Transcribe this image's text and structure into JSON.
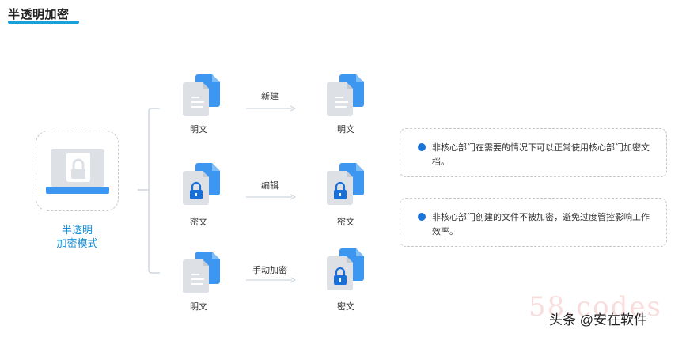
{
  "title": "半透明加密",
  "mode_label": [
    "半透明",
    "加密模式"
  ],
  "rows": [
    {
      "source_label": "明文",
      "action": "新建",
      "target_label": "明文",
      "source_locked": false,
      "target_locked": false
    },
    {
      "source_label": "密文",
      "action": "编辑",
      "target_label": "密文",
      "source_locked": true,
      "target_locked": true
    },
    {
      "source_label": "明文",
      "action": "手动加密",
      "target_label": "密文",
      "source_locked": false,
      "target_locked": true
    }
  ],
  "notes": [
    "非核心部门在需要的情况下可以正常使用核心部门加密文档。",
    "非核心部门创建的文件不被加密，避免过度管控影响工作效率。"
  ],
  "watermark": "头条 @安在软件",
  "watermark_faint": "58.codes",
  "colors": {
    "accent": "#1aa0d8",
    "doc_front": "#dde1e6",
    "doc_back": "#3d96ef",
    "lock": "#1a6fd6",
    "dot": "#1a73d9"
  },
  "icons": [
    "document-icon",
    "lock-icon",
    "laptop-lock-icon",
    "arrow-right-icon",
    "bullet-dot-icon"
  ]
}
